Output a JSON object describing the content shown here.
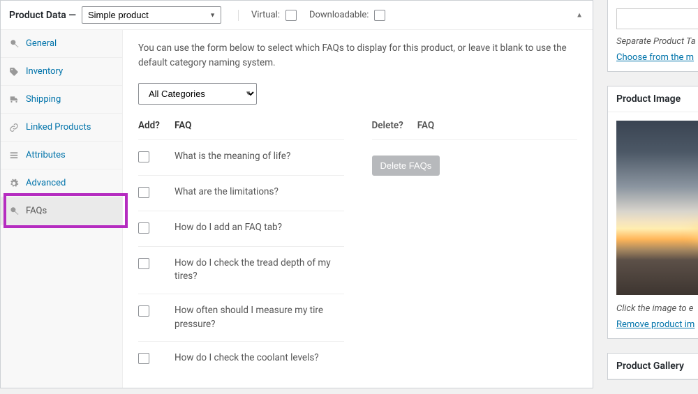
{
  "header": {
    "title": "Product Data —",
    "product_type": "Simple product",
    "virtual_label": "Virtual:",
    "downloadable_label": "Downloadable:"
  },
  "tabs": [
    {
      "label": "General",
      "icon": "wrench"
    },
    {
      "label": "Inventory",
      "icon": "tag"
    },
    {
      "label": "Shipping",
      "icon": "truck"
    },
    {
      "label": "Linked Products",
      "icon": "link"
    },
    {
      "label": "Attributes",
      "icon": "list"
    },
    {
      "label": "Advanced",
      "icon": "gear"
    },
    {
      "label": "FAQs",
      "icon": "wrench",
      "active": true
    }
  ],
  "content": {
    "description": "You can use the form below to select which FAQs to display for this product, or leave it blank to use the default category naming system.",
    "category_select": "All Categories",
    "add_head": "Add?",
    "faq_head": "FAQ",
    "delete_head": "Delete?",
    "faq_head2": "FAQ",
    "delete_button": "Delete FAQs",
    "faqs": [
      "What is the meaning of life?",
      "What are the limitations?",
      "How do I add an FAQ tab?",
      "How do I check the tread depth of my tires?",
      "How often should I measure my tire pressure?",
      "How do I check the coolant levels?"
    ]
  },
  "sidebar": {
    "tags_separate": "Separate Product Ta",
    "tags_choose": "Choose from the m",
    "product_image_title": "Product Image",
    "click_image": "Click the image to e",
    "remove_image": "Remove product im",
    "product_gallery_title": "Product Gallery"
  }
}
